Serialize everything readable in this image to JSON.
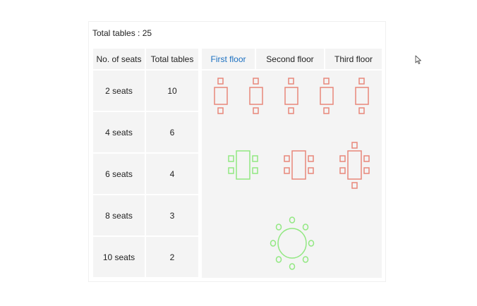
{
  "summary": {
    "total_label": "Total tables : 25"
  },
  "table": {
    "headers": {
      "seats": "No. of seats",
      "total": "Total tables"
    },
    "rows": [
      {
        "seats": "2 seats",
        "total": "10"
      },
      {
        "seats": "4 seats",
        "total": "6"
      },
      {
        "seats": "6 seats",
        "total": "4"
      },
      {
        "seats": "8 seats",
        "total": "3"
      },
      {
        "seats": "10 seats",
        "total": "2"
      }
    ]
  },
  "floors": {
    "tabs": [
      {
        "label": "First floor",
        "active": true
      },
      {
        "label": "Second floor",
        "active": false
      },
      {
        "label": "Third floor",
        "active": false
      }
    ]
  },
  "colors": {
    "accent": "#1a6fc0",
    "occupied_table": "#e8877a",
    "available_table": "#92e882",
    "panel_bg": "#f4f4f4"
  }
}
